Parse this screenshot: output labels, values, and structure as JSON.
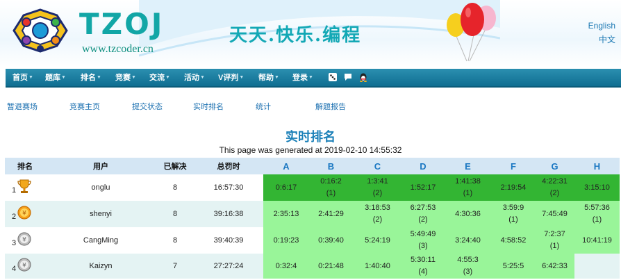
{
  "header": {
    "logo_text": "TZOJ",
    "logo_url": "www.tzcoder.cn",
    "slogan": "天天.快乐.编程",
    "lang_en": "English",
    "lang_zh": "中文"
  },
  "nav": {
    "items": [
      {
        "label": "首页"
      },
      {
        "label": "题库"
      },
      {
        "label": "排名"
      },
      {
        "label": "竞赛"
      },
      {
        "label": "交流"
      },
      {
        "label": "活动"
      },
      {
        "label": "V评判"
      },
      {
        "label": "帮助"
      },
      {
        "label": "登录"
      }
    ]
  },
  "subnav": [
    "暂退赛场",
    "竞赛主页",
    "提交状态",
    "实时排名",
    "统计",
    "解题报告"
  ],
  "page": {
    "title": "实时排名",
    "generated": "This page was generated at 2019-02-10 14:55:32"
  },
  "table": {
    "headers": [
      "排名",
      "用户",
      "已解决",
      "总罚时"
    ],
    "problems": [
      "A",
      "B",
      "C",
      "D",
      "E",
      "F",
      "G",
      "H"
    ],
    "rows": [
      {
        "rank": "1",
        "medal": "trophy",
        "user": "onglu",
        "solved": "8",
        "penalty": "16:57:30",
        "cells": [
          {
            "time": "0:6:17",
            "count": "",
            "state": "first"
          },
          {
            "time": "0:16:2",
            "count": "(1)",
            "state": "first"
          },
          {
            "time": "1:3:41",
            "count": "(2)",
            "state": "first"
          },
          {
            "time": "1:52:17",
            "count": "",
            "state": "first"
          },
          {
            "time": "1:41:38",
            "count": "(1)",
            "state": "first"
          },
          {
            "time": "2:19:54",
            "count": "",
            "state": "first"
          },
          {
            "time": "4:22:31",
            "count": "(2)",
            "state": "first"
          },
          {
            "time": "3:15:10",
            "count": "",
            "state": "first"
          }
        ]
      },
      {
        "rank": "2",
        "medal": "gold",
        "user": "shenyi",
        "solved": "8",
        "penalty": "39:16:38",
        "cells": [
          {
            "time": "2:35:13",
            "count": "",
            "state": "ac"
          },
          {
            "time": "2:41:29",
            "count": "",
            "state": "ac"
          },
          {
            "time": "3:18:53",
            "count": "(2)",
            "state": "ac"
          },
          {
            "time": "6:27:53",
            "count": "(2)",
            "state": "ac"
          },
          {
            "time": "4:30:36",
            "count": "",
            "state": "ac"
          },
          {
            "time": "3:59:9",
            "count": "(1)",
            "state": "ac"
          },
          {
            "time": "7:45:49",
            "count": "",
            "state": "ac"
          },
          {
            "time": "5:57:36",
            "count": "(1)",
            "state": "ac"
          }
        ]
      },
      {
        "rank": "3",
        "medal": "silver",
        "user": "CangMing",
        "solved": "8",
        "penalty": "39:40:39",
        "cells": [
          {
            "time": "0:19:23",
            "count": "",
            "state": "ac"
          },
          {
            "time": "0:39:40",
            "count": "",
            "state": "ac"
          },
          {
            "time": "5:24:19",
            "count": "",
            "state": "ac"
          },
          {
            "time": "5:49:49",
            "count": "(3)",
            "state": "ac"
          },
          {
            "time": "3:24:40",
            "count": "",
            "state": "ac"
          },
          {
            "time": "4:58:52",
            "count": "",
            "state": "ac"
          },
          {
            "time": "7:2:37",
            "count": "(1)",
            "state": "ac"
          },
          {
            "time": "10:41:19",
            "count": "",
            "state": "ac"
          }
        ]
      },
      {
        "rank": "4",
        "medal": "silver",
        "user": "Kaizyn",
        "solved": "7",
        "penalty": "27:27:24",
        "cells": [
          {
            "time": "0:32:4",
            "count": "",
            "state": "ac"
          },
          {
            "time": "0:21:48",
            "count": "",
            "state": "ac"
          },
          {
            "time": "1:40:40",
            "count": "",
            "state": "ac"
          },
          {
            "time": "5:30:11",
            "count": "(4)",
            "state": "ac"
          },
          {
            "time": "4:55:3",
            "count": "(3)",
            "state": "ac"
          },
          {
            "time": "5:25:5",
            "count": "",
            "state": "ac"
          },
          {
            "time": "6:42:33",
            "count": "",
            "state": "ac"
          },
          {
            "time": "",
            "count": "",
            "state": "none"
          }
        ]
      }
    ]
  },
  "colors": {
    "first_blood": "#33b533",
    "accepted": "#99f599",
    "nav_bg": "#0f6e91",
    "header_row": "#d4e6f4"
  }
}
